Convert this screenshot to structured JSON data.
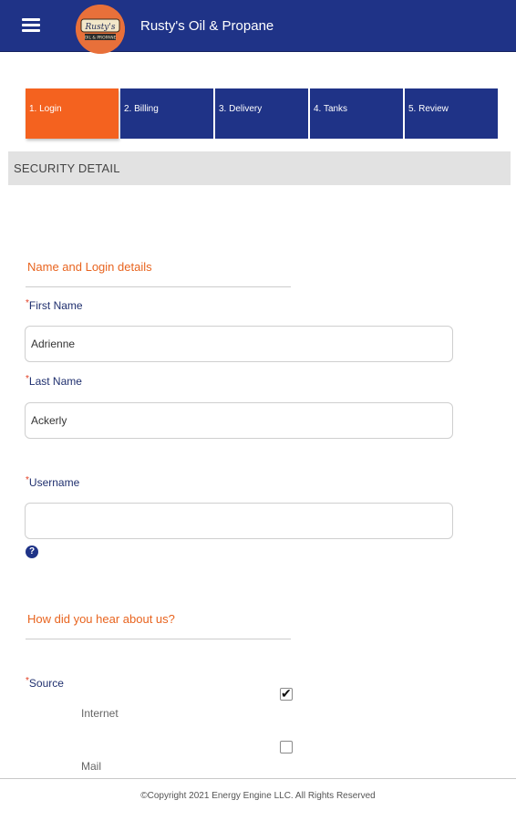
{
  "header": {
    "title": "Rusty's Oil & Propane",
    "logo_text": "Rusty's",
    "logo_subtext": "OIL & PROPANE"
  },
  "steps": [
    {
      "label": "1. Login",
      "active": true
    },
    {
      "label": "2. Billing",
      "active": false
    },
    {
      "label": "3. Delivery",
      "active": false
    },
    {
      "label": "4. Tanks",
      "active": false
    },
    {
      "label": "5. Review",
      "active": false
    }
  ],
  "section": {
    "title": "SECURITY DETAIL"
  },
  "name_section": {
    "title": "Name and Login details",
    "first_name": {
      "required_mark": "*",
      "label": "First Name",
      "value": "Adrienne"
    },
    "last_name": {
      "required_mark": "*",
      "label": "Last Name",
      "value": "Ackerly"
    },
    "username": {
      "required_mark": "*",
      "label": "Username",
      "value": "",
      "help_glyph": "?"
    }
  },
  "hear_section": {
    "title": "How did you hear about us?",
    "source": {
      "required_mark": "*",
      "label": "Source",
      "options": [
        {
          "label": "Internet",
          "checked": true,
          "mark": "✔"
        },
        {
          "label": "Mail",
          "checked": false,
          "mark": ""
        }
      ]
    }
  },
  "footer": {
    "copyright": "©Copyright 2021 Energy Engine LLC. All Rights Reserved"
  },
  "colors": {
    "primary": "#1f3387",
    "accent": "#f4621f",
    "required": "#e23b1f"
  }
}
